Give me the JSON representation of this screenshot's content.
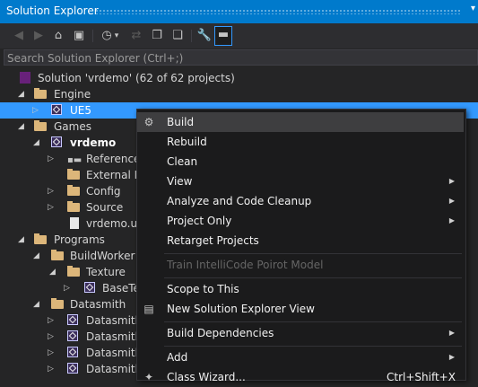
{
  "panel": {
    "title": "Solution Explorer",
    "menu_arrow": "▾",
    "search_placeholder": "Search Solution Explorer (Ctrl+;)"
  },
  "toolbar": {
    "buttons": [
      {
        "icon": "back-icon",
        "glyph": "◀"
      },
      {
        "icon": "forward-icon",
        "glyph": "▶"
      },
      {
        "icon": "home-icon",
        "glyph": "⌂"
      },
      {
        "icon": "switch-views-icon",
        "glyph": "▣"
      },
      {
        "icon": "pending-changes-icon",
        "glyph": "◷"
      },
      {
        "icon": "dropdown-icon",
        "glyph": "▾"
      },
      {
        "icon": "sync-icon",
        "glyph": "⇄"
      },
      {
        "icon": "collapse-all-icon",
        "glyph": "❐"
      },
      {
        "icon": "show-all-files-icon",
        "glyph": "❏"
      },
      {
        "icon": "properties-icon",
        "glyph": "🔧"
      },
      {
        "icon": "preview-icon",
        "glyph": "▬"
      }
    ]
  },
  "tree": {
    "solution": "Solution 'vrdemo' (62 of 62 projects)",
    "engine": "Engine",
    "ue5": "UE5",
    "games": "Games",
    "vrdemo": "vrdemo",
    "references": "References",
    "external_deps": "External De",
    "config": "Config",
    "source": "Source",
    "uproject": "vrdemo.up",
    "programs": "Programs",
    "buildworker": "BuildWorker",
    "texture": "Texture",
    "basetex": "BaseTex",
    "datasmith": "Datasmith",
    "datasmith_children": [
      "Datasmith",
      "Datasmith",
      "Datasmith",
      "Datasmith"
    ]
  },
  "context_menu": {
    "build": "Build",
    "rebuild": "Rebuild",
    "clean": "Clean",
    "view": "View",
    "analyze": "Analyze and Code Cleanup",
    "project_only": "Project Only",
    "retarget": "Retarget Projects",
    "train": "Train IntelliCode Poirot Model",
    "scope": "Scope to This",
    "new_view": "New Solution Explorer View",
    "build_deps": "Build Dependencies",
    "add": "Add",
    "class_wizard": "Class Wizard...",
    "class_wizard_shortcut": "Ctrl+Shift+X",
    "submenu_arrow": "▶"
  },
  "colors": {
    "accent": "#007acc",
    "selection": "#3399ff",
    "background": "#252526",
    "menu_background": "#1b1b1c"
  }
}
